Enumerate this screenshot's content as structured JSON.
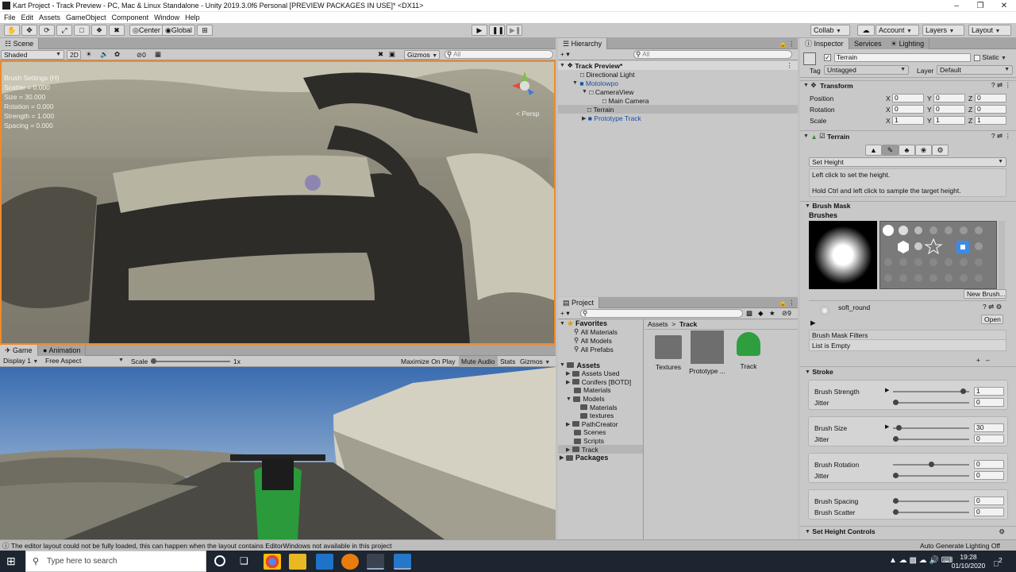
{
  "window": {
    "title": "Kart Project - Track Preview - PC, Mac & Linux Standalone - Unity 2019.3.0f6 Personal [PREVIEW PACKAGES IN USE]* <DX11>"
  },
  "menu": [
    "File",
    "Edit",
    "Assets",
    "GameObject",
    "Component",
    "Window",
    "Help"
  ],
  "toolbar": {
    "center": "Center",
    "global": "Global",
    "collab": "Collab",
    "account": "Account",
    "layers": "Layers",
    "layout": "Layout"
  },
  "scene": {
    "tab_scene": "Scene",
    "shading": "Shaded",
    "mode_2d": "2D",
    "hidden_count": "0",
    "gizmos": "Gizmos",
    "search": "All",
    "overlay": [
      "Brush Settings (H)",
      "Scatter = 0.000",
      "Size = 30.000",
      "Rotation = 0.000",
      "Strength = 1.000",
      "Spacing = 0.000"
    ],
    "persp": "< Persp"
  },
  "game": {
    "tab_game": "Game",
    "tab_animation": "Animation",
    "display": "Display 1",
    "aspect": "Free Aspect",
    "scale_label": "Scale",
    "scale_value": "1x",
    "maximize": "Maximize On Play",
    "mute": "Mute Audio",
    "stats": "Stats",
    "gizmos": "Gizmos"
  },
  "hierarchy": {
    "tab": "Hierarchy",
    "search": "All",
    "items": [
      {
        "label": "Track Preview*",
        "indent": 0,
        "bold": true
      },
      {
        "label": "Directional Light",
        "indent": 1
      },
      {
        "label": "Motolowpo",
        "indent": 1,
        "blue": true
      },
      {
        "label": "CameraView",
        "indent": 2
      },
      {
        "label": "Main Camera",
        "indent": 3
      },
      {
        "label": "Terrain",
        "indent": 1,
        "selected": true
      },
      {
        "label": "Prototype Track",
        "indent": 1,
        "blue": true
      }
    ]
  },
  "project": {
    "tab": "Project",
    "hidden_count": "9",
    "favorites": {
      "label": "Favorites",
      "items": [
        "All Materials",
        "All Models",
        "All Prefabs"
      ]
    },
    "assets": {
      "label": "Assets",
      "items": [
        {
          "label": "Assets Used",
          "indent": 1
        },
        {
          "label": "Conifers [BOTD]",
          "indent": 1
        },
        {
          "label": "Materials",
          "indent": 1
        },
        {
          "label": "Models",
          "indent": 1
        },
        {
          "label": "Materials",
          "indent": 2
        },
        {
          "label": "textures",
          "indent": 2
        },
        {
          "label": "PathCreator",
          "indent": 1
        },
        {
          "label": "Scenes",
          "indent": 1
        },
        {
          "label": "Scripts",
          "indent": 1
        },
        {
          "label": "Track",
          "indent": 1,
          "selected": true
        }
      ]
    },
    "packages": "Packages",
    "breadcrumb": [
      "Assets",
      "Track"
    ],
    "files": [
      "Textures",
      "Prototype ...",
      "Track"
    ]
  },
  "inspector": {
    "tab": "Inspector",
    "tab_services": "Services",
    "tab_lighting": "Lighting",
    "object_name": "Terrain",
    "static": "Static",
    "tag_label": "Tag",
    "tag": "Untagged",
    "layer_label": "Layer",
    "layer": "Default",
    "transform": {
      "title": "Transform",
      "rows": [
        {
          "label": "Position",
          "x": "0",
          "y": "0",
          "z": "0"
        },
        {
          "label": "Rotation",
          "x": "0",
          "y": "0",
          "z": "0"
        },
        {
          "label": "Scale",
          "x": "1",
          "y": "1",
          "z": "1"
        }
      ]
    },
    "terrain": {
      "title": "Terrain",
      "tool": "Set Height",
      "help1": "Left click to set the height.",
      "help2": "Hold Ctrl and left click to sample the target height."
    },
    "brush_mask": {
      "title": "Brush Mask",
      "brushes": "Brushes",
      "new_brush": "New Brush...",
      "brush_name": "soft_round",
      "open": "Open",
      "filters": "Brush Mask Filters",
      "list_empty": "List is Empty"
    },
    "stroke": {
      "title": "Stroke",
      "groups": [
        [
          {
            "label": "Brush Strength",
            "value": "1",
            "pos": 0.96
          },
          {
            "label": "Jitter",
            "value": "0",
            "pos": 0.0
          }
        ],
        [
          {
            "label": "Brush Size",
            "value": "30",
            "pos": 0.05
          },
          {
            "label": "Jitter",
            "value": "0",
            "pos": 0.0
          }
        ],
        [
          {
            "label": "Brush Rotation",
            "value": "0",
            "pos": 0.5
          },
          {
            "label": "Jitter",
            "value": "0",
            "pos": 0.0
          }
        ],
        [
          {
            "label": "Brush Spacing",
            "value": "0",
            "pos": 0.0
          },
          {
            "label": "Brush Scatter",
            "value": "0",
            "pos": 0.0
          }
        ]
      ]
    },
    "set_height": "Set Height Controls"
  },
  "status": {
    "message": "The editor layout could not be fully loaded, this can happen when the layout contains EditorWindows not available in this project",
    "lighting": "Auto Generate Lighting Off"
  },
  "taskbar": {
    "search": "Type here to search",
    "time": "19:28",
    "date": "01/10/2020",
    "notifications": "2"
  }
}
